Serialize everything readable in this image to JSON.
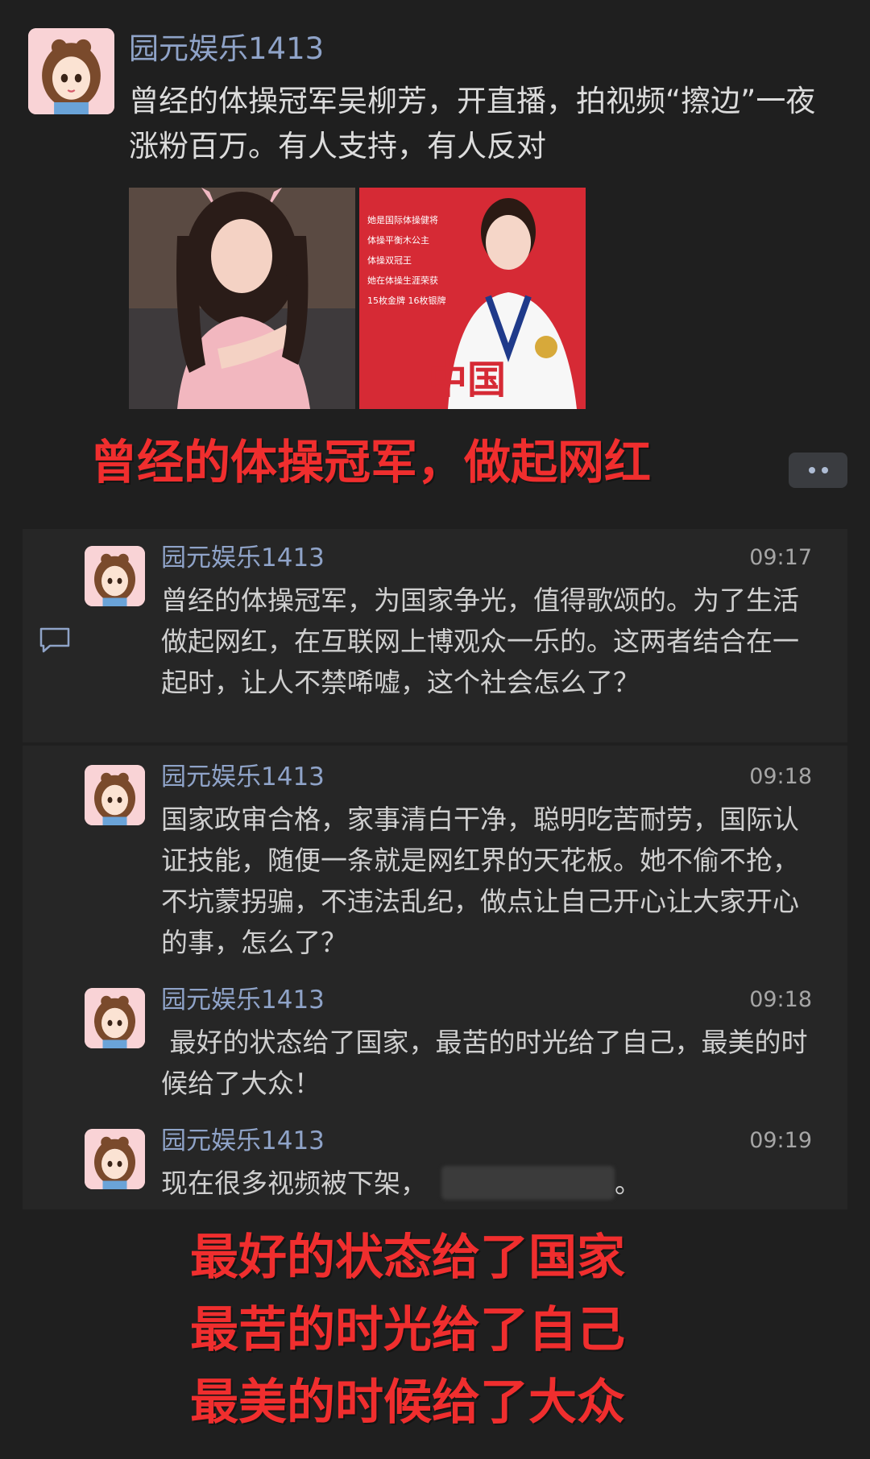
{
  "post": {
    "username": "园元娱乐1413",
    "text": "曾经的体操冠军吴柳芳，开直播，拍视频“擦边”一夜涨粉百万。有人支持，有人反对",
    "images": [
      {
        "name": "photo-woman-pink"
      },
      {
        "name": "photo-gymnast-medal",
        "caption_lines": [
          "她是国际体操健将",
          "体操平衡木公主",
          "体操双冠王",
          "她在体操生涯荣获",
          "15枚金牌 16枚银牌"
        ],
        "badge": "中国"
      }
    ]
  },
  "overlay_title": "曾经的体操冠军，做起网红",
  "comments": [
    {
      "username": "园元娱乐1413",
      "time": "09:17",
      "text": "曾经的体操冠军，为国家争光，值得歌颂的。为了生活做起网红，在互联网上博观众一乐的。这两者结合在一起时，让人不禁唏嘘，这个社会怎么了？"
    },
    {
      "username": "园元娱乐1413",
      "time": "09:18",
      "text": "国家政审合格，家事清白干净，聪明吃苦耐劳，国际认证技能，随便一条就是网红界的天花板。她不偷不抢，不坑蒙拐骗，不违法乱纪，做点让自己开心让大家开心的事，怎么了？"
    },
    {
      "username": "园元娱乐1413",
      "time": "09:18",
      "text": " 最好的状态给了国家，最苦的时光给了自己，最美的时候给了大众！"
    },
    {
      "username": "园元娱乐1413",
      "time": "09:19",
      "text": "现在很多视频被下架，",
      "text_end": "。"
    }
  ],
  "overlay_bottom": [
    "最好的状态给了国家",
    "最苦的时光给了自己",
    "最美的时候给了大众"
  ],
  "colors": {
    "accent_name": "#8fa3c8",
    "overlay_red": "#f02e2e",
    "background": "#1f1f1f",
    "comment_bg": "#262626"
  }
}
